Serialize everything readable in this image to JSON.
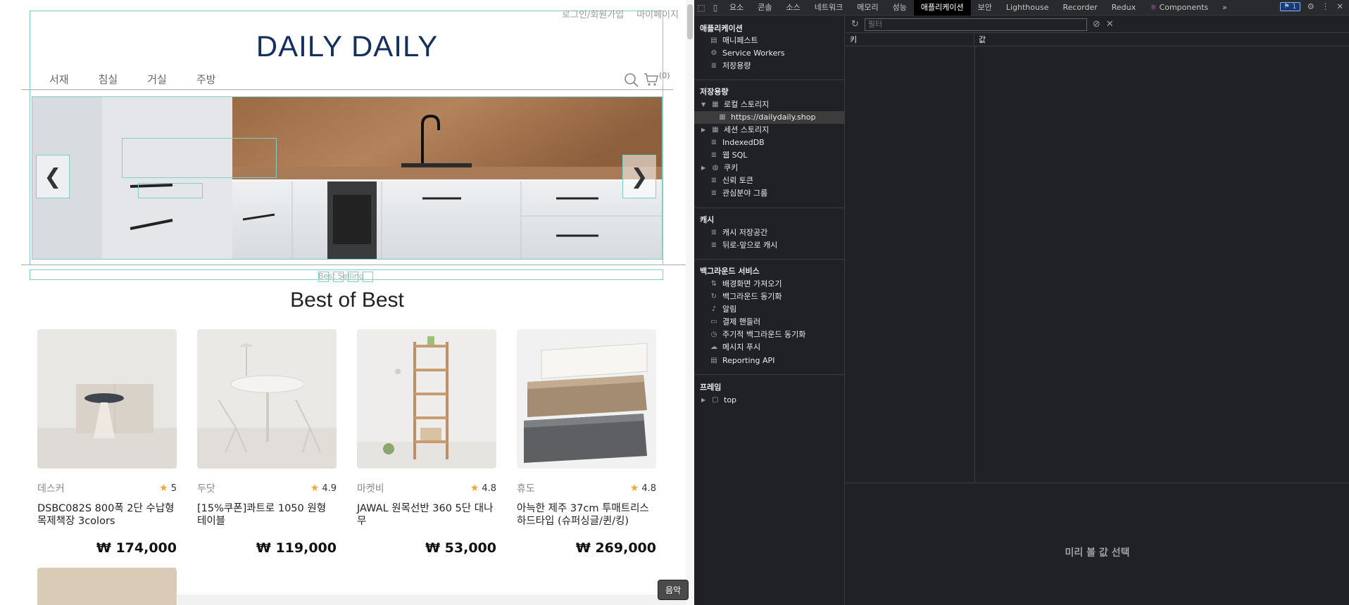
{
  "site": {
    "top_links": [
      "로그인/회원가입",
      "마이페이지"
    ],
    "logo": "DAILY DAILY",
    "nav": [
      "서재",
      "침실",
      "거실",
      "주방"
    ],
    "cart_count": "(0)",
    "prev_arrow": "❮",
    "next_arrow": "❯",
    "dots_label": "Best Selling",
    "section_title": "Best of Best",
    "products": [
      {
        "brand": "데스커",
        "rating": "5",
        "name": "DSBC082S 800폭 2단 수납형 목제책장 3colors",
        "price": "₩ 174,000"
      },
      {
        "brand": "두닷",
        "rating": "4.9",
        "name": "[15%쿠폰]콰트로 1050 원형 테이블",
        "price": "₩ 119,000"
      },
      {
        "brand": "마켓비",
        "rating": "4.8",
        "name": "JAWAL 원목선반 360 5단 대나무",
        "price": "₩ 53,000"
      },
      {
        "brand": "휴도",
        "rating": "4.8",
        "name": "아늑한 제주 37cm 투매트리스 하드타입 (슈퍼싱글/퀸/킹)",
        "price": "₩ 269,000"
      }
    ],
    "music_tooltip": "음악",
    "colors": {
      "logo": "#14305c",
      "star": "#f0a63a",
      "outline": "#7fcfc6"
    }
  },
  "devtools": {
    "tabs": [
      "요소",
      "콘솔",
      "소스",
      "네트워크",
      "메모리",
      "성능",
      "애플리케이션",
      "보안",
      "Lighthouse",
      "Recorder",
      "Redux",
      "Components"
    ],
    "active_tab": "애플리케이션",
    "issues_badge": "1",
    "sections": {
      "application": {
        "title": "애플리케이션",
        "items": [
          "매니페스트",
          "Service Workers",
          "저장용량"
        ]
      },
      "storage": {
        "title": "저장용량",
        "local_storage": "로컬 스토리지",
        "local_origin": "https://dailydaily.shop",
        "session_storage": "세션 스토리지",
        "indexeddb": "IndexedDB",
        "websql": "웹 SQL",
        "cookies": "쿠키",
        "trust_tokens": "신뢰 토큰",
        "interest_groups": "관심분야 그룹"
      },
      "cache": {
        "title": "캐시",
        "items": [
          "캐시 저장공간",
          "뒤로-앞으로 캐시"
        ]
      },
      "background": {
        "title": "백그라운드 서비스",
        "items": [
          "배경화면 가져오기",
          "백그라운드 동기화",
          "알림",
          "결제 핸들러",
          "주기적 백그라운드 동기화",
          "메시지 푸시",
          "Reporting API"
        ]
      },
      "frames": {
        "title": "프레임",
        "top": "top"
      }
    },
    "filter_placeholder": "필터",
    "table": {
      "key_header": "키",
      "value_header": "값"
    },
    "preview_text": "미리 볼 값 선택"
  }
}
